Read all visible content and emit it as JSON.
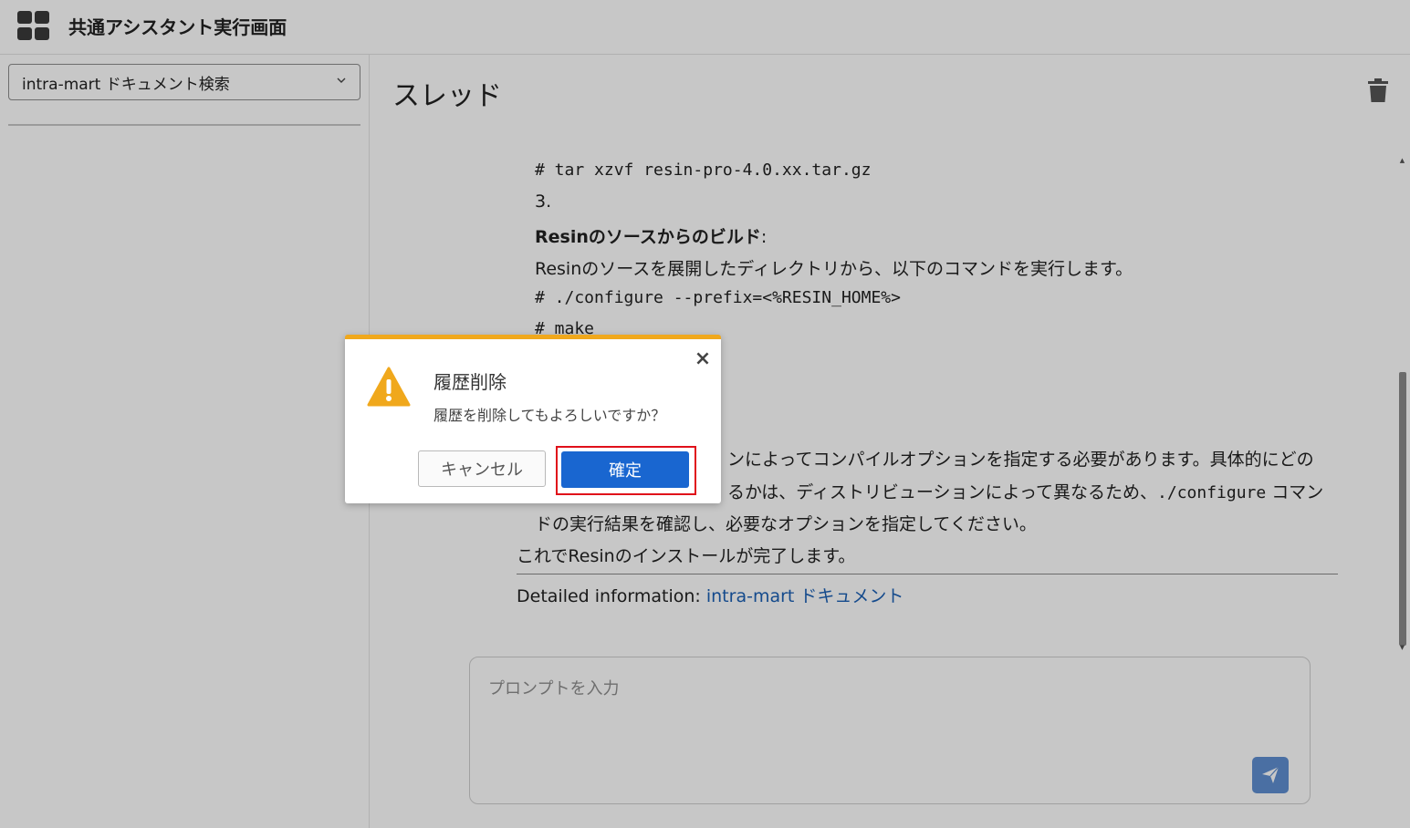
{
  "header": {
    "app_title": "共通アシスタント実行画面",
    "menu_icon": "grid-menu-icon"
  },
  "sidebar": {
    "assistant_select": {
      "selected": "intra-mart ドキュメント検索",
      "icon": "chevron-down-icon"
    }
  },
  "main": {
    "thread_title": "スレッド",
    "delete_icon": "trash-icon",
    "message": {
      "code_tar": "# tar xzvf resin-pro-4.0.xx.tar.gz",
      "step_number": "3.",
      "step_heading": "Resinのソースからのビルド",
      "step_heading_suffix": ":",
      "step_text": "Resinのソースを展開したディレクトリから、以下のコマンドを実行します。",
      "code_configure": "# ./configure --prefix=<%RESIN_HOME%>",
      "code_make": "# make",
      "note_line1": "ンによってコンパイルオプションを指定する必要があります。具体的にどの",
      "note_line2_a": "るかは、ディストリビューションによって異なるため、",
      "note_line2_code": "./configure",
      "note_line2_b": " コマン",
      "note_line3": "ドの実行結果を確認し、必要なオプションを指定してください。",
      "summary": "これでResinのインストールが完了します。",
      "detail_label": "Detailed information: ",
      "detail_link": "intra-mart ドキュメント"
    },
    "prompt": {
      "placeholder": "プロンプトを入力",
      "send_icon": "send-icon"
    }
  },
  "dialog": {
    "title": "履歴削除",
    "message": "履歴を削除してもよろしいですか？",
    "close_label": "×",
    "cancel_label": "キャンセル",
    "confirm_label": "確定",
    "warning_icon": "warning-icon",
    "accent_color": "#f0a81c",
    "confirm_color": "#1966d0",
    "highlight_color": "#e0101a"
  }
}
